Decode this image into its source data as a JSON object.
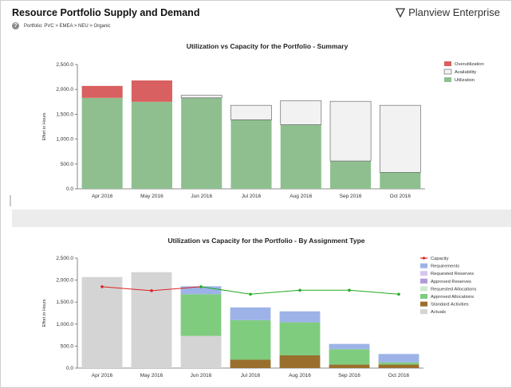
{
  "header": {
    "title": "Resource Portfolio Supply and Demand",
    "brand": "Planview Enterprise",
    "help_icon": "?",
    "breadcrumb": "Portfolio: PVC > EMEA > NEU > Organic"
  },
  "chart_data": [
    {
      "type": "bar",
      "title": "Utilization vs Capacity for the Portfolio - Summary",
      "xlabel": "",
      "ylabel": "Effort in Hours",
      "ylim": [
        0,
        2500
      ],
      "yticks": [
        "0.0",
        "500.0",
        "1,000.0",
        "1,500.0",
        "2,000.0",
        "2,500.0"
      ],
      "categories": [
        "Apr 2016",
        "May 2016",
        "Jun 2016",
        "Jul 2016",
        "Aug 2016",
        "Sep 2016",
        "Oct 2016"
      ],
      "stacked": true,
      "legend_position": "right",
      "series": [
        {
          "name": "Utilization",
          "color": "#8fbf8f",
          "values": [
            1830,
            1750,
            1830,
            1390,
            1290,
            560,
            330
          ]
        },
        {
          "name": "Availability",
          "color": "#f2f2f2",
          "values": [
            0,
            0,
            50,
            290,
            480,
            1200,
            1350
          ]
        },
        {
          "name": "Overutilization",
          "color": "#d96060",
          "values": [
            240,
            430,
            0,
            0,
            0,
            0,
            0
          ]
        }
      ],
      "legend": [
        "Overutilization",
        "Availability",
        "Utilization"
      ]
    },
    {
      "type": "bar",
      "title": "Utilization vs Capacity for the Portfolio - By Assignment Type",
      "xlabel": "",
      "ylabel": "Effort in Hours",
      "ylim": [
        0,
        2500
      ],
      "yticks": [
        "0.0",
        "500.0",
        "1,000.0",
        "1,500.0",
        "2,000.0",
        "2,500.0"
      ],
      "categories": [
        "Apr 2016",
        "May 2016",
        "Jun 2016",
        "Jul 2016",
        "Aug 2016",
        "Sep 2016",
        "Oct 2016"
      ],
      "stacked": true,
      "legend_position": "right",
      "series": [
        {
          "name": "Actuals",
          "color": "#d4d4d4",
          "values": [
            2070,
            2180,
            730,
            0,
            0,
            0,
            0
          ]
        },
        {
          "name": "Standard Activities",
          "color": "#9a6f2d",
          "values": [
            0,
            0,
            0,
            190,
            290,
            80,
            80
          ]
        },
        {
          "name": "Approved Allocations",
          "color": "#7fcc7f",
          "values": [
            0,
            0,
            950,
            900,
            750,
            350,
            50
          ]
        },
        {
          "name": "Requested Allocations",
          "color": "#cfe8cf",
          "values": [
            0,
            0,
            0,
            0,
            0,
            0,
            0
          ]
        },
        {
          "name": "Approved Reserves",
          "color": "#b09bd6",
          "values": [
            0,
            0,
            0,
            0,
            0,
            0,
            0
          ]
        },
        {
          "name": "Requested Reserves",
          "color": "#d6c6ec",
          "values": [
            0,
            0,
            0,
            0,
            0,
            0,
            0
          ]
        },
        {
          "name": "Requirements",
          "color": "#9db3e8",
          "values": [
            0,
            0,
            180,
            290,
            250,
            120,
            190
          ]
        }
      ],
      "line_series": {
        "name": "Capacity",
        "color": "#dd2222",
        "values": [
          1850,
          1760,
          1850,
          1680,
          1770,
          1770,
          1680
        ],
        "marker_color": "#22aa22"
      },
      "legend": [
        "Capacity",
        "Requirements",
        "Requested Reserves",
        "Approved Reserves",
        "Requested Allocations",
        "Approved Allocations",
        "Standard Activities",
        "Actuals"
      ]
    }
  ]
}
